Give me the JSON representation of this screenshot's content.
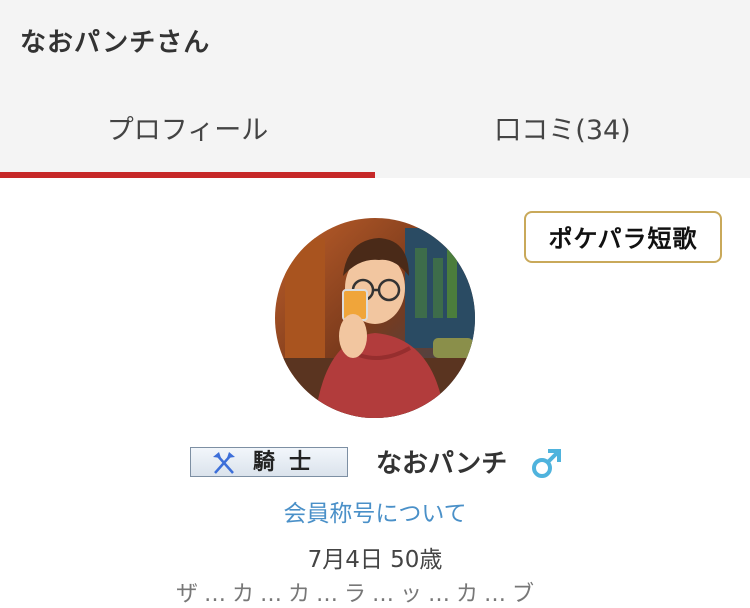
{
  "page": {
    "title": "なおパンチさん"
  },
  "tabs": [
    {
      "label": "プロフィール",
      "active": true
    },
    {
      "label": "口コミ(34)",
      "active": false
    }
  ],
  "colors": {
    "accent": "#c62828",
    "link": "#4a90c8",
    "badge_border": "#c9a95a",
    "male": "#4fb3dd"
  },
  "badge": {
    "label": "ポケパラ短歌"
  },
  "profile": {
    "rank": {
      "label": "騎士",
      "icon": "crossed-axes-icon"
    },
    "username": "なおパンチ",
    "gender_icon": "male-icon",
    "title_link": "会員称号について",
    "birth_age": "7月4日 50歳",
    "cut_text": "ザ…カ…カ…ラ…ッ…カ…ブ"
  }
}
